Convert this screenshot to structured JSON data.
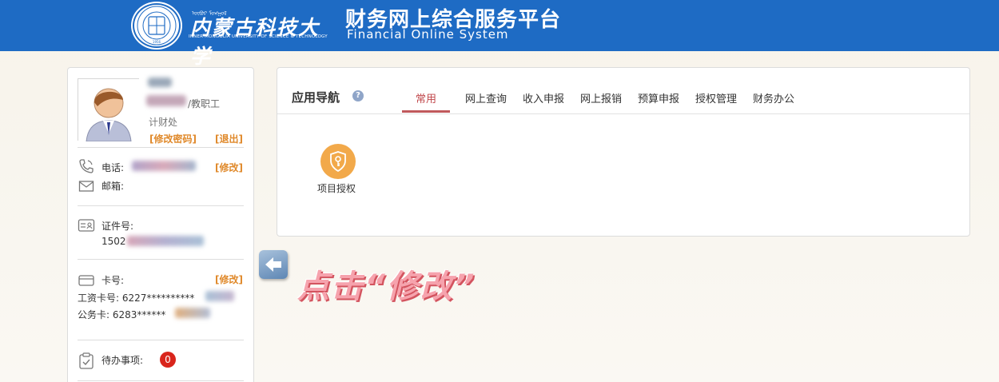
{
  "header": {
    "univ_name_cn": "内蒙古科技大学",
    "univ_name_en": "INNER MONGOLIA UNIVERSITY OF SCIENCE & TECHNOLOGY",
    "univ_mongolian": "ᠥᠪᠥᠷ ᠮᠣᠩᠭᠣᠯ",
    "seal_text": "内蒙古科技大学",
    "system_title": "财务网上综合服务平台",
    "system_subtitle": "Financial  Online  System"
  },
  "user": {
    "role_suffix": "/教职工",
    "department": "计财处",
    "change_password": "[修改密码]",
    "logout": "[退出]",
    "phone_label": "电话:",
    "phone_edit": "[修改]",
    "email_label": "邮箱:",
    "id_label": "证件号:",
    "id_prefix": "1502",
    "card_label": "卡号:",
    "card_edit": "[修改]",
    "salary_card": "工资卡号: 6227**********",
    "official_card": "公务卡: 6283******",
    "todo_label": "待办事项:",
    "todo_count": "0"
  },
  "nav": {
    "title": "应用导航",
    "help": "?",
    "tabs": [
      "常用",
      "网上查询",
      "收入申报",
      "网上报销",
      "预算申报",
      "授权管理",
      "财务办公"
    ],
    "active_tab": "常用"
  },
  "apps": [
    {
      "label": "项目授权",
      "icon": "shield-key-icon"
    }
  ],
  "annotation": {
    "text": "点击“修改”"
  },
  "colors": {
    "header_bg": "#1e6bc4",
    "accent_orange": "#e08a2c",
    "active_tab": "#c0464a",
    "badge_red": "#d9251c",
    "app_icon": "#f2a94a"
  }
}
